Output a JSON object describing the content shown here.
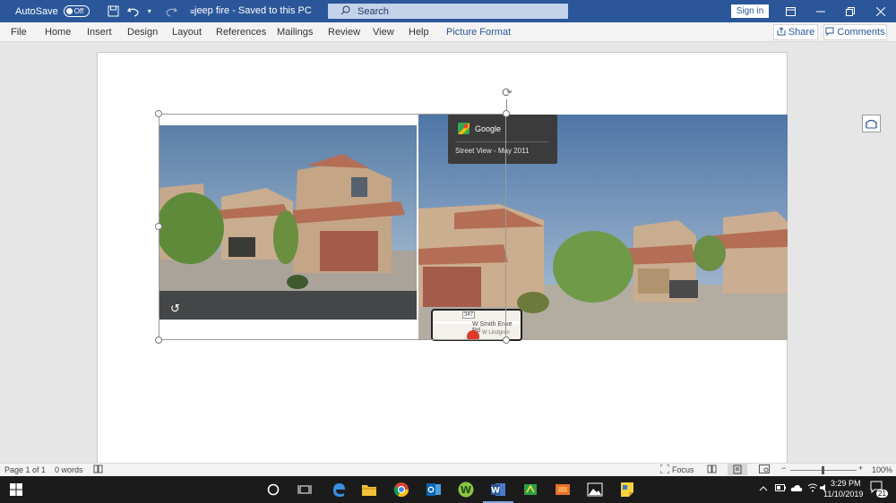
{
  "titlebar": {
    "autosave_label": "AutoSave",
    "autosave_state": "Off",
    "doc_title": "jeep fire  -  Saved to this PC",
    "search_placeholder": "Search",
    "signin_label": "Sign in"
  },
  "ribbon": {
    "tabs": [
      "File",
      "Home",
      "Insert",
      "Design",
      "Layout",
      "References",
      "Mailings",
      "Review",
      "View",
      "Help",
      "Picture Format"
    ],
    "share_label": "Share",
    "comments_label": "Comments"
  },
  "picture_overlay": {
    "menu_item": "Google",
    "caption": "Street View - May 2011",
    "map_road": "W Smith Enke Rd",
    "map_street": "W Lindgren",
    "map_route": "347"
  },
  "status": {
    "page": "Page 1 of 1",
    "words": "0 words",
    "focus": "Focus",
    "zoom": "100%",
    "zoom_minus": "−",
    "zoom_plus": "+"
  },
  "taskbar": {
    "time": "3:29 PM",
    "date": "11/10/2019",
    "notifications": "21"
  },
  "colors": {
    "word_blue": "#2b579a",
    "taskbar": "#1b1b1b"
  }
}
